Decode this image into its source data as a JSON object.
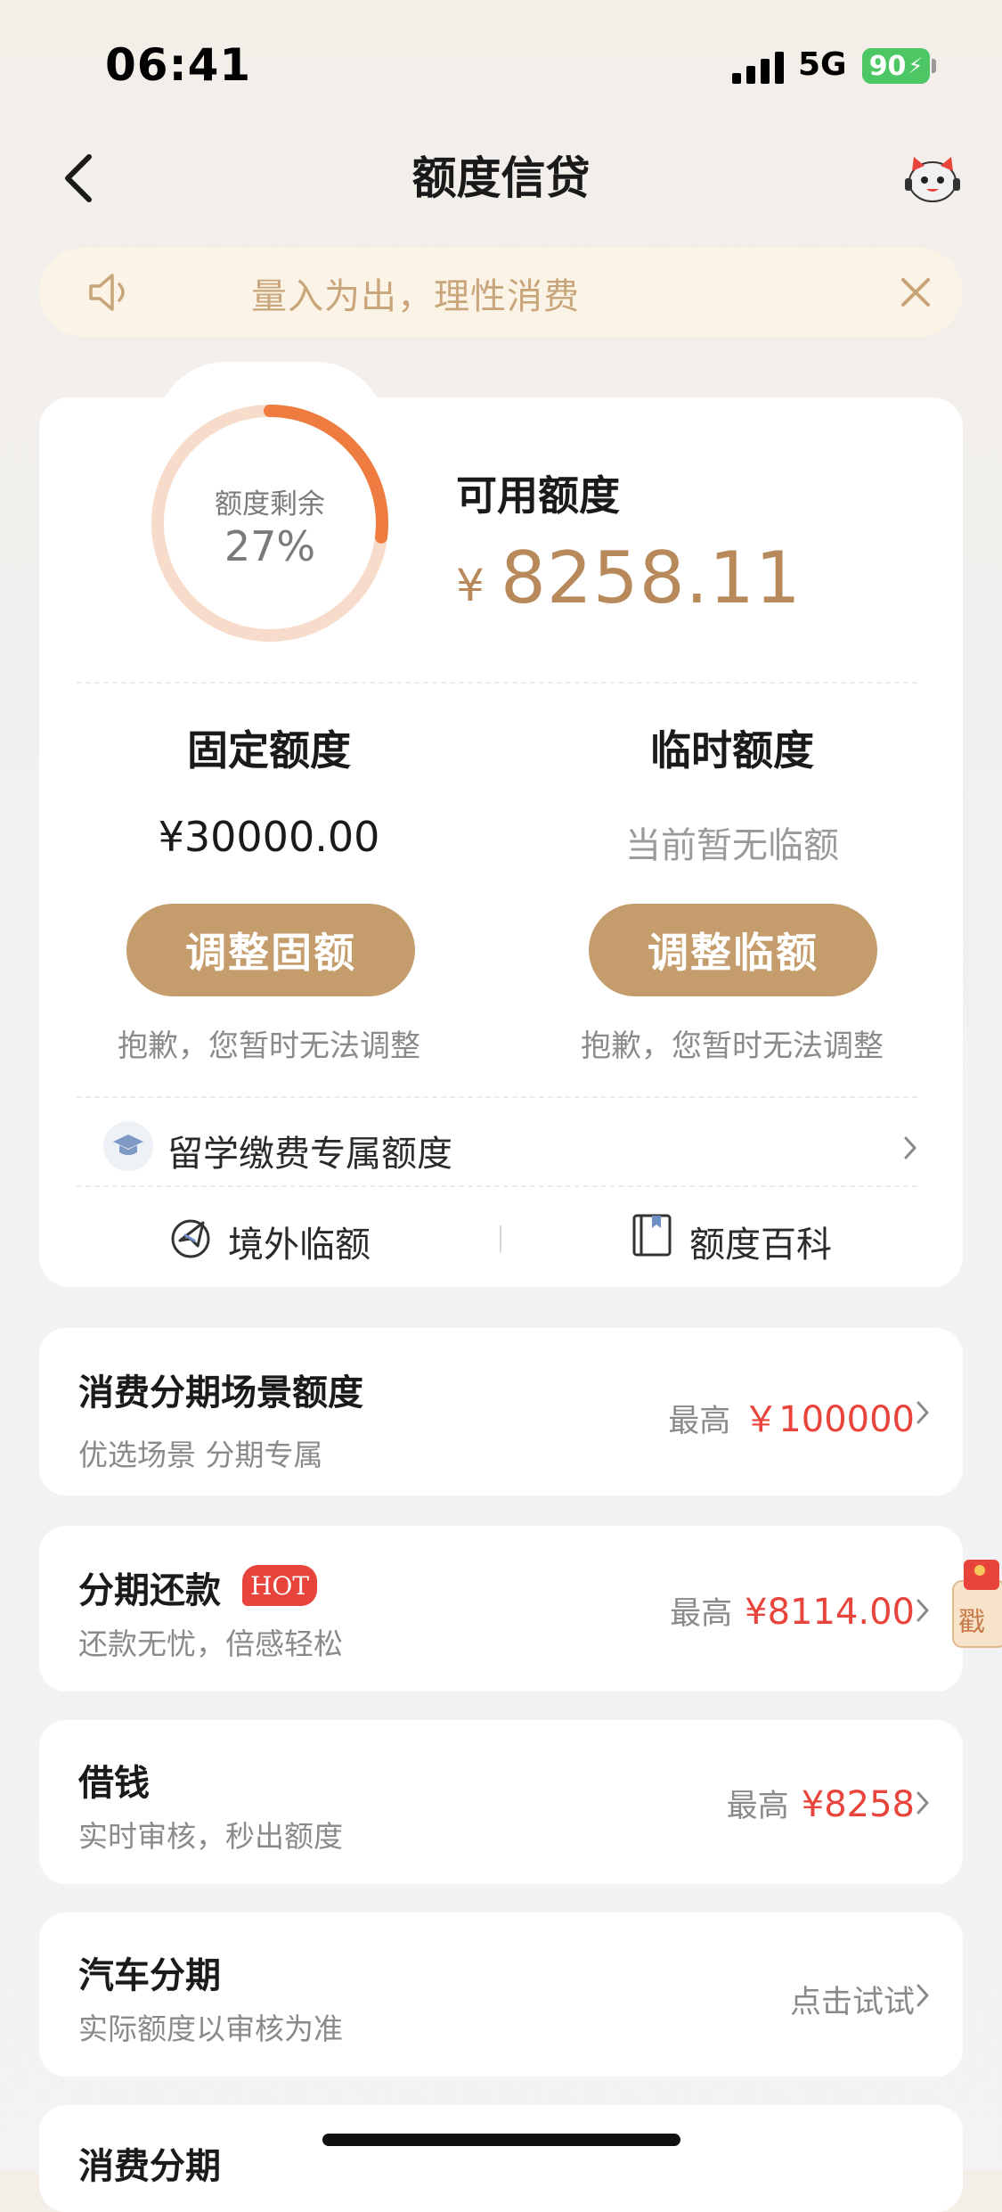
{
  "status_bar": {
    "time": "06:41",
    "network": "5G",
    "battery": "90"
  },
  "nav": {
    "title": "额度信贷"
  },
  "notice": {
    "text": "量入为出，理性消费"
  },
  "credit": {
    "ring_label": "额度剩余",
    "ring_percent": "27%",
    "ring_fraction": 0.27,
    "available_label": "可用额度",
    "available_currency": "¥",
    "available_amount": "8258.11",
    "fixed": {
      "title": "固定额度",
      "value": "¥30000.00",
      "button": "调整固额",
      "note": "抱歉，您暂时无法调整"
    },
    "temp": {
      "title": "临时额度",
      "value": "当前暂无临额",
      "button": "调整临额",
      "note": "抱歉，您暂时无法调整"
    },
    "study_label": "留学缴费专属额度",
    "links": {
      "overseas": "境外临额",
      "encyclopedia": "额度百科"
    }
  },
  "list": [
    {
      "title": "消费分期场景额度",
      "subtitle": "优选场景 分期专属",
      "prefix": "最高",
      "amount": "￥100000"
    },
    {
      "title": "分期还款",
      "badge": "HOT",
      "subtitle": "还款无忧，倍感轻松",
      "prefix": "最高",
      "amount": "¥8114.00"
    },
    {
      "title": "借钱",
      "subtitle": "实时审核，秒出额度",
      "prefix": "最高",
      "amount": "¥8258"
    },
    {
      "title": "汽车分期",
      "subtitle": "实际额度以审核为准",
      "action": "点击试试"
    },
    {
      "title": "消费分期"
    }
  ],
  "floating": {
    "label": "戳"
  },
  "colors": {
    "gold": "#c59d6c",
    "gold_text": "#b8895a",
    "ring_active": "#ee7b3f",
    "ring_track": "#f8dccb",
    "price_red": "#e8443b",
    "notice_bg": "#fbf4e6"
  }
}
